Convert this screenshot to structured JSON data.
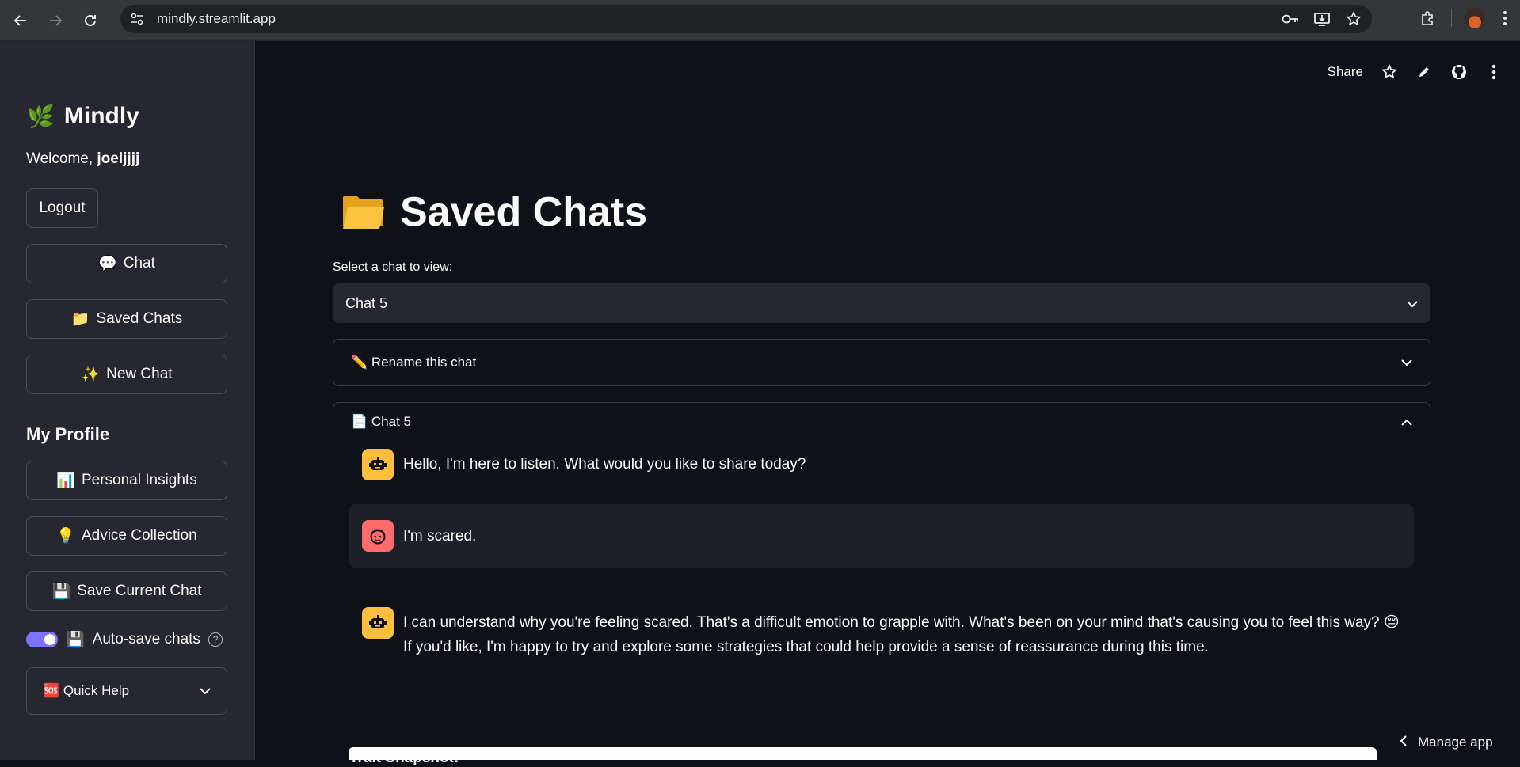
{
  "browser": {
    "url": "mindly.streamlit.app"
  },
  "sidebar": {
    "brand_icon": "🌿",
    "brand_name": "Mindly",
    "welcome_prefix": "Welcome, ",
    "username": "joeljjjj",
    "logout_label": "Logout",
    "nav": [
      {
        "icon": "💬",
        "label": "Chat"
      },
      {
        "icon": "📁",
        "label": "Saved Chats"
      },
      {
        "icon": "✨",
        "label": "New Chat"
      }
    ],
    "profile_title": "My Profile",
    "profile_items": [
      {
        "icon": "📊",
        "label": "Personal Insights"
      },
      {
        "icon": "💡",
        "label": "Advice Collection"
      },
      {
        "icon": "💾",
        "label": "Save Current Chat"
      }
    ],
    "autosave": {
      "icon": "💾",
      "label": "Auto-save chats",
      "enabled": true,
      "help": "?"
    },
    "quick_help": {
      "icon": "🆘",
      "label": "Quick Help"
    }
  },
  "toolbar": {
    "share_label": "Share"
  },
  "main": {
    "title": "Saved Chats",
    "select_label": "Select a chat to view:",
    "selected_chat": "Chat 5",
    "rename_expander": {
      "icon": "✏️",
      "label": "Rename this chat"
    },
    "chat_expander": {
      "icon": "📄",
      "label": "Chat 5"
    },
    "messages": [
      {
        "role": "assistant",
        "text": "Hello, I'm here to listen. What would you like to share today?"
      },
      {
        "role": "user",
        "text": "I'm scared."
      },
      {
        "role": "assistant",
        "text": "I can understand why you're feeling scared. That's a difficult emotion to grapple with. What's been on your mind that's causing you to feel this way? 😔 If you'd like, I'm happy to try and explore some strategies that could help provide a sense of reassurance during this time."
      }
    ],
    "trait_title": "Trait Snapshot:"
  },
  "manage_app_label": "Manage app",
  "colors": {
    "accent": "#7b74ff",
    "bot_avatar": "#fdbd3d",
    "user_avatar": "#ff6c6c",
    "sidebar_bg": "#262730",
    "main_bg": "#0e1117"
  }
}
